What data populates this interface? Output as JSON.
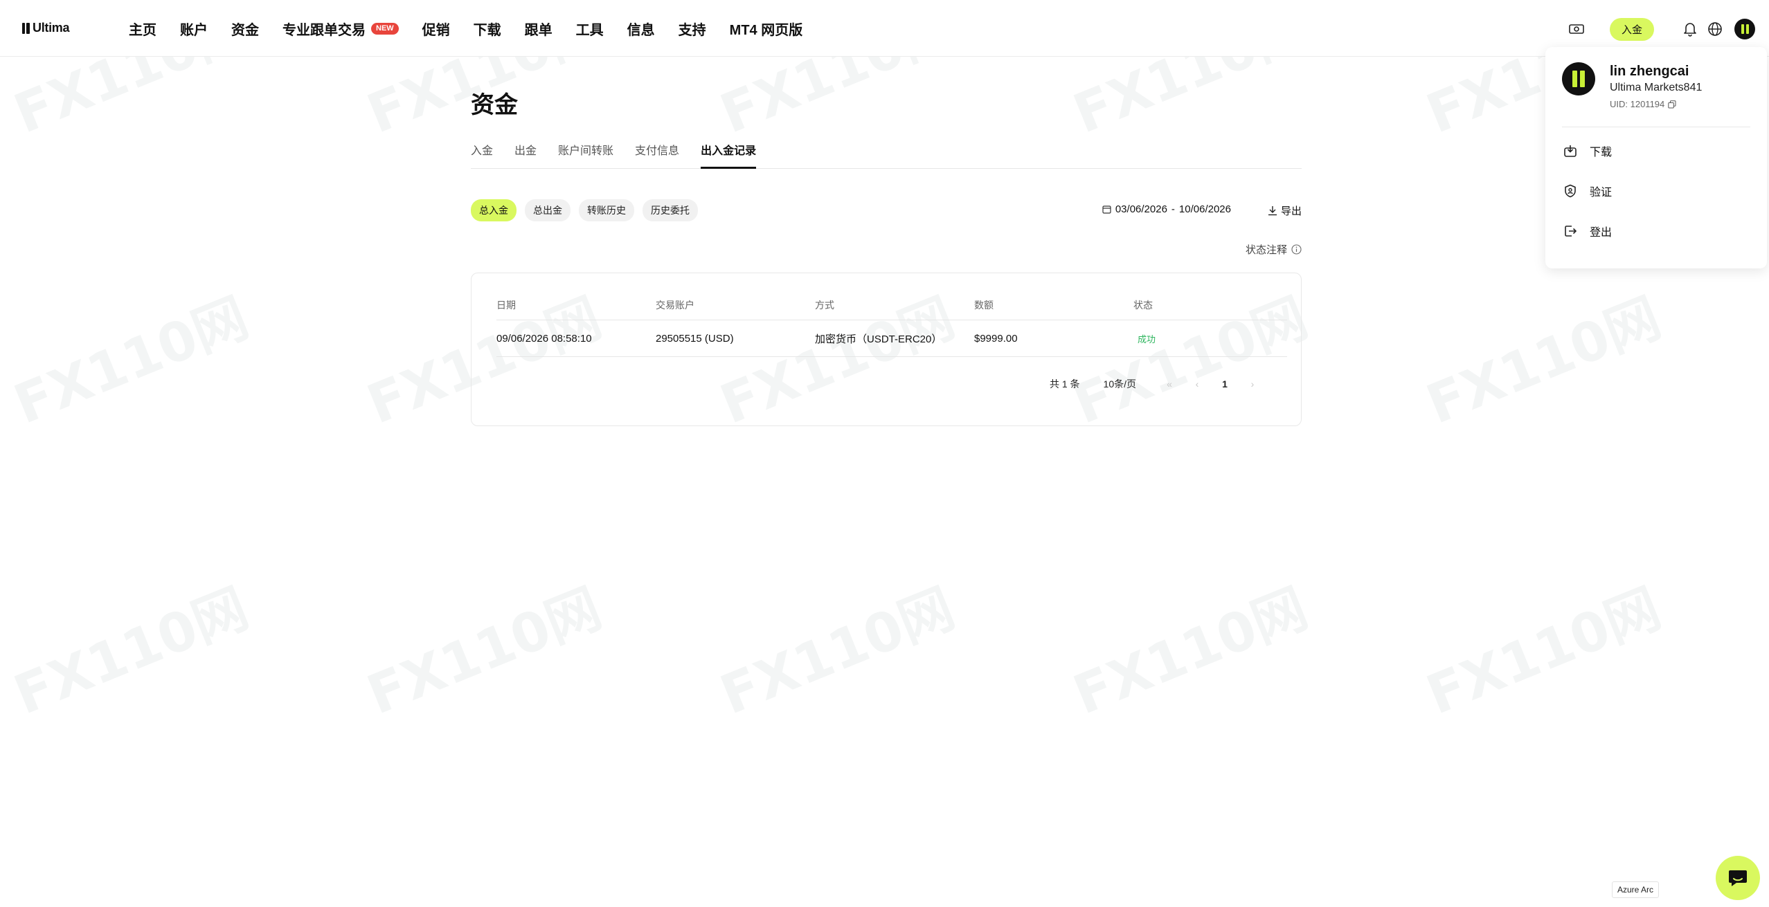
{
  "app": {
    "logo_text": "Ultima"
  },
  "nav": {
    "items": [
      "主页",
      "账户",
      "资金",
      "专业跟单交易",
      "促销",
      "下载",
      "跟单",
      "工具",
      "信息",
      "支持",
      "MT4 网页版"
    ],
    "new_badge": "NEW",
    "deposit_label": "入金"
  },
  "page": {
    "title": "资金",
    "tabs": [
      "入金",
      "出金",
      "账户间转账",
      "支付信息",
      "出入金记录"
    ],
    "active_tab": "出入金记录",
    "filters": [
      "总入金",
      "总出金",
      "转账历史",
      "历史委托"
    ],
    "active_filter": "总入金",
    "date_from": "03/06/2026",
    "date_sep": "-",
    "date_to": "10/06/2026",
    "export_label": "导出",
    "status_note_label": "状态注释"
  },
  "table": {
    "headers": [
      "日期",
      "交易账户",
      "方式",
      "数额",
      "状态"
    ],
    "rows": [
      {
        "date": "09/06/2026 08:58:10",
        "account": "29505515 (USD)",
        "method": "加密货币（USDT-ERC20）",
        "amount": "$9999.00",
        "status": "成功"
      }
    ],
    "pagination": {
      "total": "共 1 条",
      "page_size": "10条/页",
      "current_page": "1"
    }
  },
  "user_menu": {
    "name": "lin zhengcai",
    "subtitle": "Ultima Markets841",
    "uid": "UID: 1201194",
    "items": [
      {
        "label": "下载",
        "icon": "download-box-icon"
      },
      {
        "label": "验证",
        "icon": "shield-check-icon"
      },
      {
        "label": "登出",
        "icon": "logout-icon"
      }
    ]
  },
  "footer": {
    "azure_label": "Azure Arc"
  },
  "watermark_text": "FX110网",
  "colors": {
    "accent": "#d9f85f",
    "badge_red": "#e8453c",
    "success": "#2db55d",
    "text": "#111111"
  }
}
